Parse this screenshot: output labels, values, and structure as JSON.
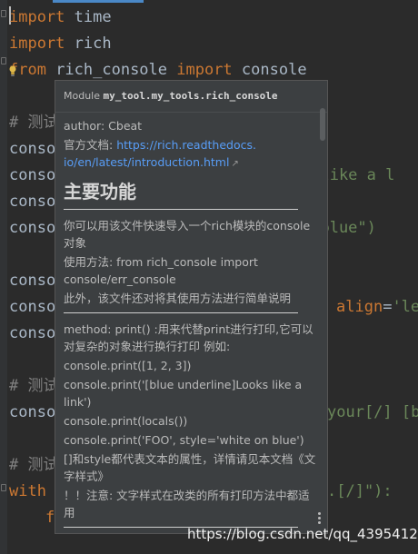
{
  "editor": {
    "lines": [
      {
        "a": "import",
        "b": " time"
      },
      {
        "a": "import",
        "b": " rich"
      },
      {
        "a": "from",
        "b": " rich_console ",
        "c": "import",
        "d": " console"
      }
    ],
    "fragments": {
      "l4": "# 测试",
      "l5": "conso",
      "l6": "conso",
      "l6r": "s like a l",
      "l7": "conso",
      "l8": "conso",
      "l8r": "n blue\")",
      "l10": "conso",
      "l11": "conso",
      "l11r_kw": "align",
      "l11r_eq": "=",
      "l11r_str": "'le",
      "l12": "conso",
      "l14": "# 测试",
      "l15": "conso",
      "l15r": "your[/] [b",
      "l17": "# 测试",
      "l18": "with",
      "l18r": ".[/]\"):",
      "l19": "f"
    }
  },
  "popup": {
    "header_prefix": "Module ",
    "module": "my_tool.my_tools.rich_console",
    "author": "author: Cbeat",
    "doc_label": "官方文档: ",
    "doc_link_1": "https://rich.readthedocs.",
    "doc_link_2": "io/en/latest/introduction.html",
    "ext_icon": "↗",
    "heading": "主要功能",
    "p1": "你可以用该文件快速导入一个rich模块的console对象",
    "p2": "使用方法: from rich_console import console/err_console",
    "p3": "此外，该文件还对将其使用方法进行简单说明",
    "m1": "method: print() :用来代替print进行打印,它可以对复杂的对象进行换行打印 例如:",
    "m2": "console.print([1, 2, 3])",
    "m3": "console.print('[blue underline]Looks like a link')",
    "m4": "console.print(locals())",
    "m5": "console.print('FOO', style='white on blue')",
    "m6": "[]和style都代表文本的属性，详情请见本文档《文字样式》",
    "m7": "！！注意: 文字样式在改类的所有打印方法中都适用"
  },
  "watermark": "https://blog.csdn.net/qq_43954124"
}
